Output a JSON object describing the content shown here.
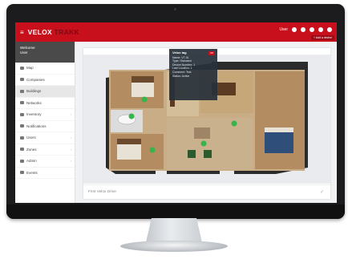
{
  "header": {
    "menu_icon": "hamburger-icon",
    "logo_left": "VELOX",
    "logo_right": "TRAKK",
    "user_label": "User",
    "add_button": "+ Add a device",
    "icons": [
      "user-icon",
      "gear-icon",
      "bell-icon",
      "expand-icon",
      "power-icon"
    ],
    "accent": "#c8101d"
  },
  "sidebar": {
    "user_line1": "Welcome",
    "user_line2": "User",
    "items": [
      {
        "label": "Map",
        "icon": "map-icon",
        "active": false,
        "chev": false
      },
      {
        "label": "Companies",
        "icon": "company-icon",
        "active": false,
        "chev": false
      },
      {
        "label": "Buildings",
        "icon": "building-icon",
        "active": true,
        "chev": false
      },
      {
        "label": "Networks",
        "icon": "network-icon",
        "active": false,
        "chev": false
      },
      {
        "label": "Inventory",
        "icon": "inventory-icon",
        "active": false,
        "chev": true
      },
      {
        "label": "Notifications",
        "icon": "bell-icon",
        "active": false,
        "chev": false
      },
      {
        "label": "Users",
        "icon": "users-icon",
        "active": false,
        "chev": true
      },
      {
        "label": "Zones",
        "icon": "zone-icon",
        "active": false,
        "chev": true
      },
      {
        "label": "Admin",
        "icon": "admin-icon",
        "active": false,
        "chev": true
      },
      {
        "label": "Events",
        "icon": "events-icon",
        "active": false,
        "chev": false
      }
    ]
  },
  "main": {
    "pager": "‹ 1 ›",
    "footer_text": "First Velox Drive",
    "footer_icon": "check-icon"
  },
  "popup": {
    "title": "Velox tag",
    "badge": "Off",
    "rows": [
      "Name: VT-01",
      "Type: Standard",
      "Device Number: 1",
      "Last Location: 1",
      "Comment: Test",
      "Status: Active"
    ]
  }
}
